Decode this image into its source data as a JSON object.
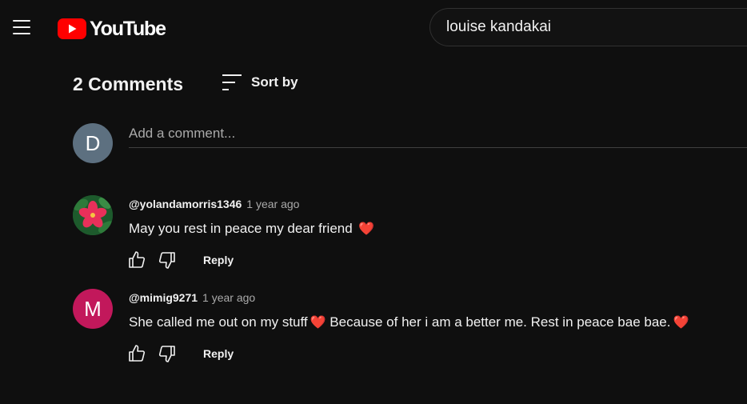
{
  "header": {
    "logo_text": "YouTube",
    "search": {
      "value": "louise kandakai"
    }
  },
  "comments_header": {
    "count_label": "2 Comments",
    "sort_label": "Sort by"
  },
  "add_comment": {
    "avatar_letter": "D",
    "placeholder": "Add a comment..."
  },
  "comments": [
    {
      "author": "@yolandamorris1346",
      "time": "1 year ago",
      "text": "May you rest in peace my dear friend",
      "emoji": "❤️",
      "reply_label": "Reply"
    },
    {
      "author": "@mimig9271",
      "time": "1 year ago",
      "avatar_letter": "M",
      "text_parts": [
        "She called me out on my stuff",
        "❤️",
        " Because of her i am a better me. Rest in peace bae bae.",
        "❤️"
      ],
      "reply_label": "Reply"
    }
  ],
  "colors": {
    "background": "#0f0f0f",
    "brand_red": "#ff0000",
    "heart": "#e0245e",
    "avatar_d": "#5d7080",
    "avatar_m": "#c2185b"
  }
}
